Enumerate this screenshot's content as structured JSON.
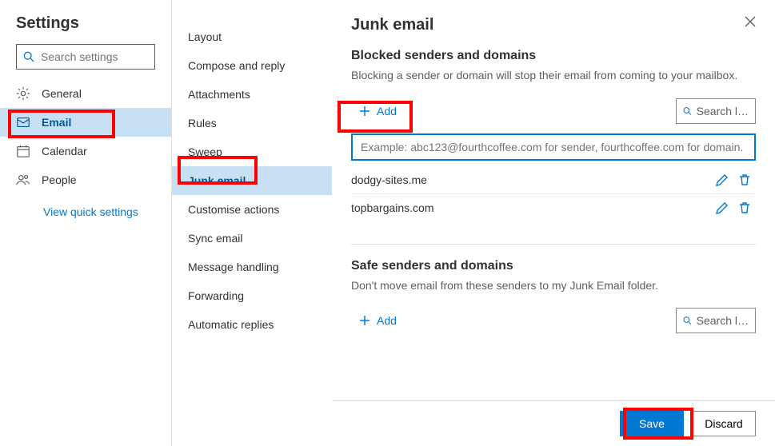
{
  "settings": {
    "title": "Settings",
    "search_placeholder": "Search settings",
    "nav": [
      {
        "icon": "gear",
        "label": "General"
      },
      {
        "icon": "mail",
        "label": "Email"
      },
      {
        "icon": "calendar",
        "label": "Calendar"
      },
      {
        "icon": "people",
        "label": "People"
      }
    ],
    "quick_link": "View quick settings"
  },
  "subnav": {
    "items": [
      "Layout",
      "Compose and reply",
      "Attachments",
      "Rules",
      "Sweep",
      "Junk email",
      "Customise actions",
      "Sync email",
      "Message handling",
      "Forwarding",
      "Automatic replies"
    ]
  },
  "main": {
    "title": "Junk email",
    "blocked": {
      "heading": "Blocked senders and domains",
      "description": "Blocking a sender or domain will stop their email from coming to your mailbox.",
      "add_label": "Add",
      "search_label": "Search l…",
      "input_placeholder": "Example: abc123@fourthcoffee.com for sender, fourthcoffee.com for domain.",
      "entries": [
        "dodgy-sites.me",
        "topbargains.com"
      ]
    },
    "safe": {
      "heading": "Safe senders and domains",
      "description": "Don't move email from these senders to my Junk Email folder.",
      "add_label": "Add",
      "search_label": "Search l…"
    },
    "footer": {
      "save": "Save",
      "discard": "Discard"
    }
  }
}
